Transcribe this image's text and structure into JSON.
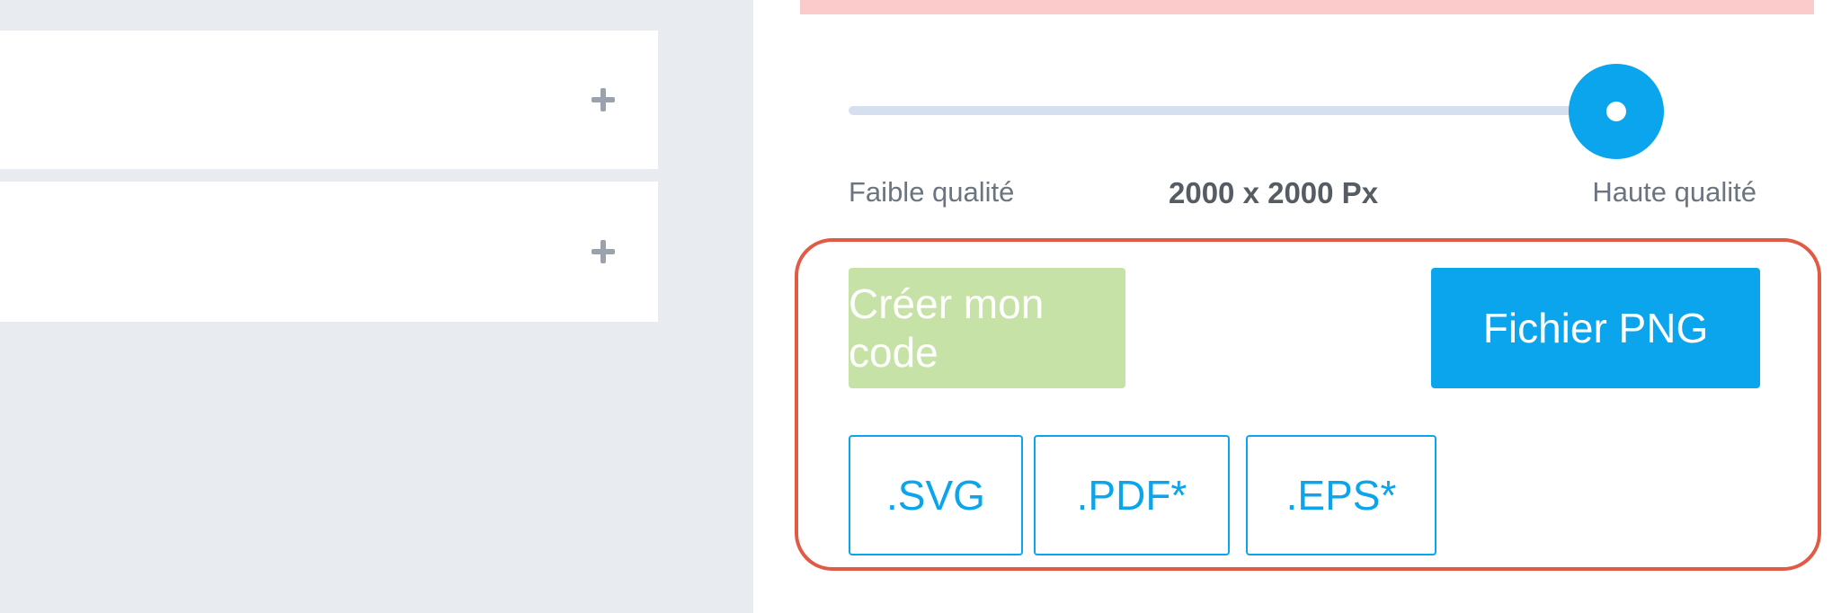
{
  "quality": {
    "low_label": "Faible qualité",
    "size_label": "2000 x 2000 Px",
    "high_label": "Haute qualité",
    "slider_fraction": 1.0
  },
  "actions": {
    "create_label": "Créer mon code",
    "png_label": "Fichier PNG"
  },
  "formats": [
    ".SVG",
    ".PDF*",
    ".EPS*"
  ],
  "colors": {
    "accent": "#0aa5ec",
    "create_disabled": "#c7e2a6",
    "highlight": "#e05a44",
    "alert": "#fbcaca"
  }
}
